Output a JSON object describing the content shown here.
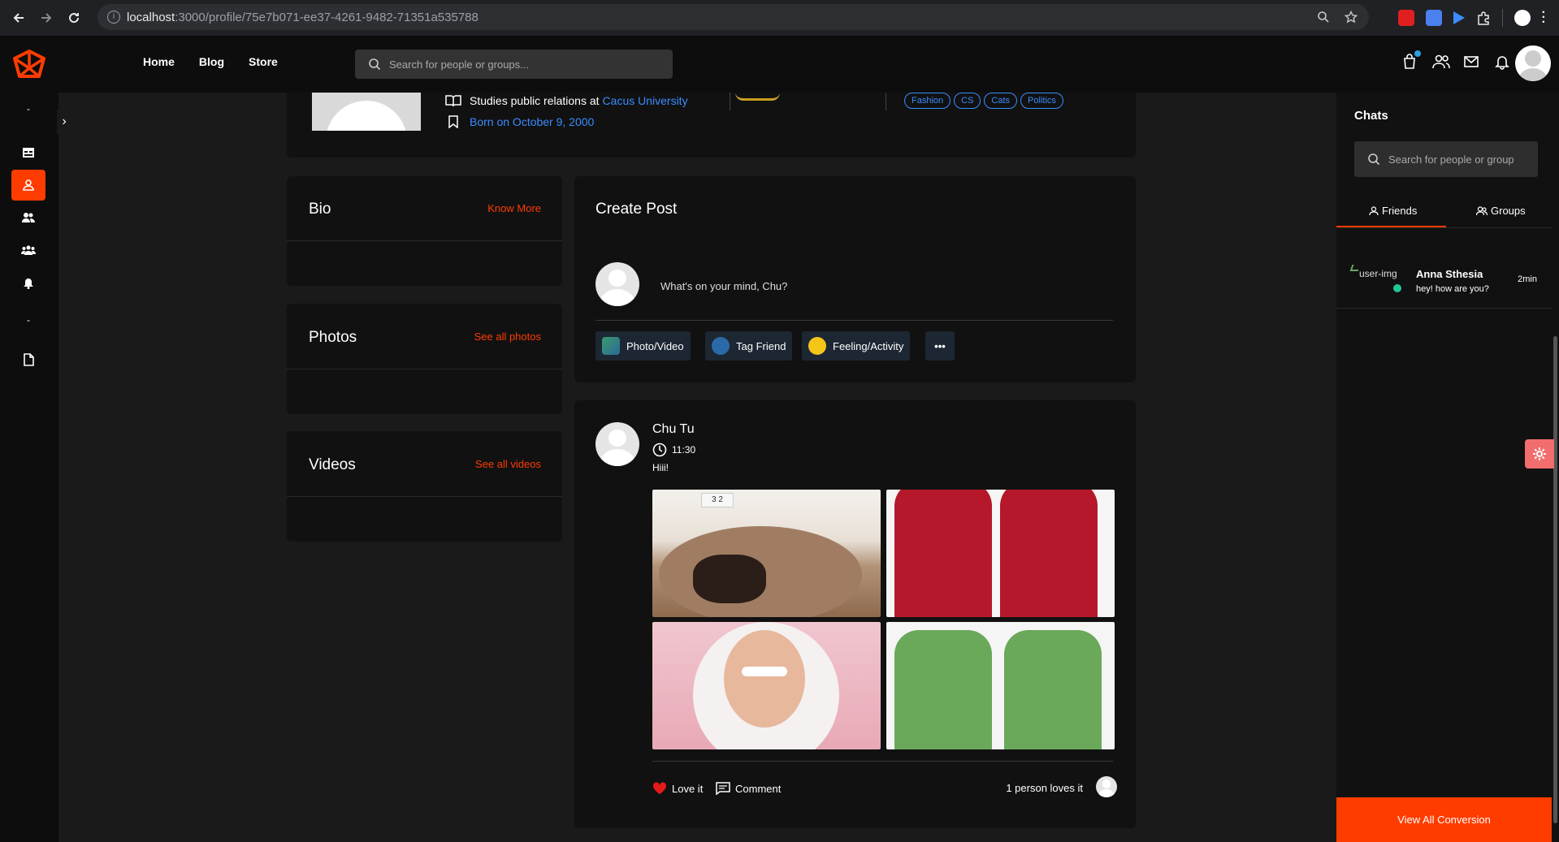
{
  "browser": {
    "url_host": "localhost",
    "url_path": ":3000/profile/75e7b071-ee37-4261-9482-71351a535788"
  },
  "header": {
    "nav": [
      "Home",
      "Blog",
      "Store"
    ],
    "search_placeholder": "Search for people or groups..."
  },
  "profile": {
    "study_prefix": "Studies public relations at",
    "study_school": "Cacus University",
    "born": "Born on October 9, 2000",
    "tags": [
      "Fashion",
      "CS",
      "Cats",
      "Politics"
    ]
  },
  "left_cards": {
    "bio": {
      "title": "Bio",
      "link": "Know More"
    },
    "photos": {
      "title": "Photos",
      "link": "See all photos"
    },
    "videos": {
      "title": "Videos",
      "link": "See all videos"
    }
  },
  "create_post": {
    "title": "Create Post",
    "placeholder": "What's on your mind, Chu?",
    "buttons": [
      "Photo/Video",
      "Tag Friend",
      "Feeling/Activity"
    ]
  },
  "post": {
    "author": "Chu Tu",
    "time": "11:30",
    "text": "Hiii!",
    "love_label": "Love it",
    "comment_label": "Comment",
    "loves_text": "1 person loves it",
    "image_note": "3 2"
  },
  "chats": {
    "title": "Chats",
    "search_placeholder": "Search for people or group",
    "tabs": [
      "Friends",
      "Groups"
    ],
    "items": [
      {
        "img_alt": "user-img",
        "name": "Anna Sthesia",
        "message": "hey! how are you?",
        "time": "2min"
      }
    ],
    "view_all": "View All Conversion"
  },
  "colors": {
    "accent": "#ff3c00",
    "link": "#3b8cff",
    "online": "#20c997"
  }
}
